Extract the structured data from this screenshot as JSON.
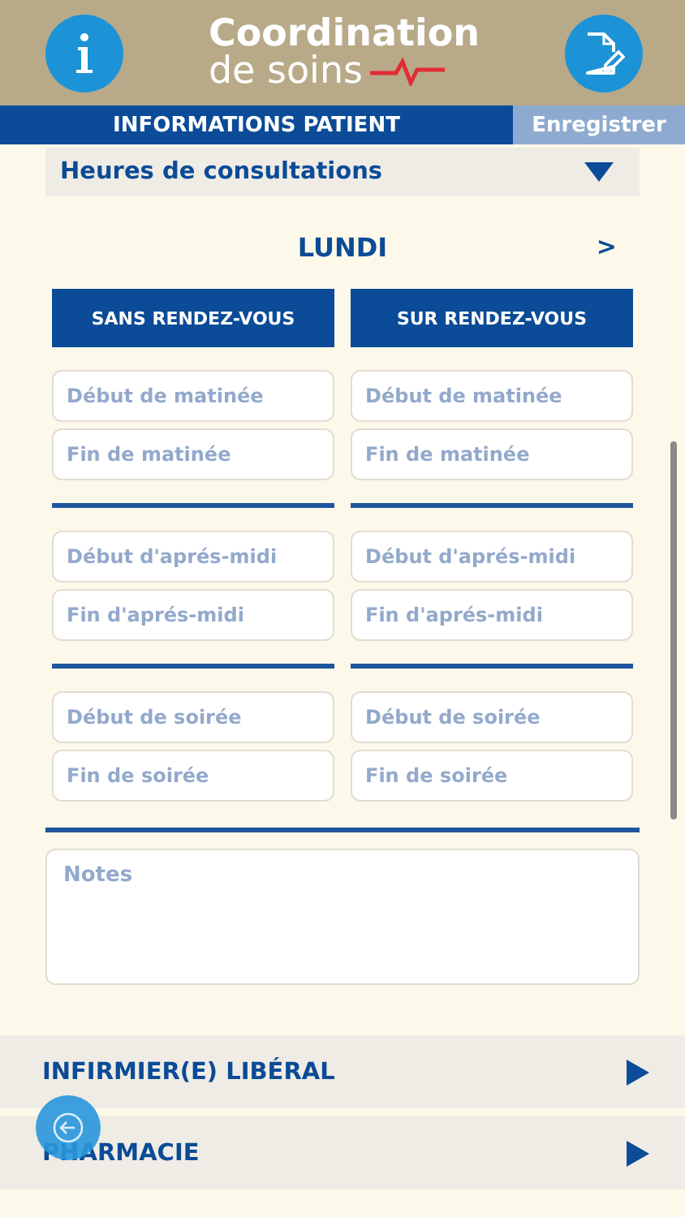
{
  "header": {
    "title_line1": "Coordination",
    "title_line2": "de soins"
  },
  "nav": {
    "title": "INFORMATIONS PATIENT",
    "save": "Enregistrer"
  },
  "section": {
    "title": "Heures de consultations",
    "expanded": true
  },
  "day": {
    "label": "LUNDI",
    "next": ">"
  },
  "columns": [
    {
      "header": "SANS RENDEZ-VOUS",
      "groups": [
        [
          {
            "placeholder": "Début de matinée"
          },
          {
            "placeholder": "Fin de matinée"
          }
        ],
        [
          {
            "placeholder": "Début d'aprés-midi"
          },
          {
            "placeholder": "Fin d'aprés-midi"
          }
        ],
        [
          {
            "placeholder": "Début de soirée"
          },
          {
            "placeholder": "Fin de soirée"
          }
        ]
      ]
    },
    {
      "header": "SUR RENDEZ-VOUS",
      "groups": [
        [
          {
            "placeholder": "Début de matinée"
          },
          {
            "placeholder": "Fin de matinée"
          }
        ],
        [
          {
            "placeholder": "Début d'aprés-midi"
          },
          {
            "placeholder": "Fin d'aprés-midi"
          }
        ],
        [
          {
            "placeholder": "Début de soirée"
          },
          {
            "placeholder": "Fin de soirée"
          }
        ]
      ]
    }
  ],
  "notes": {
    "placeholder": "Notes"
  },
  "sections": [
    {
      "title": "INFIRMIER(E) LIBÉRAL",
      "expanded": false
    },
    {
      "title": "PHARMACIE",
      "expanded": false
    }
  ]
}
